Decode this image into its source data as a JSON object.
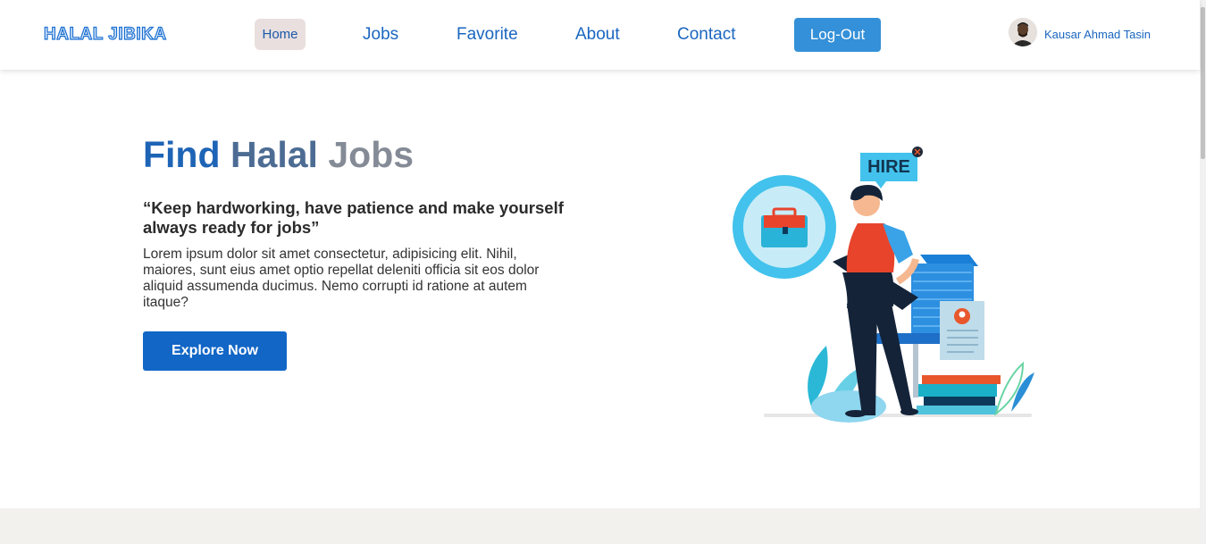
{
  "navbar": {
    "logo": "HALAL JIBIKA",
    "links": [
      "Home",
      "Jobs",
      "Favorite",
      "About",
      "Contact"
    ],
    "logout_label": "Log-Out",
    "user_name": "Kausar Ahmad Tasin"
  },
  "hero": {
    "title_part1": "Find",
    "title_part2": "Halal",
    "title_part3": "Jobs",
    "quote": "“Keep hardworking, have patience and make yourself always ready for jobs”",
    "description": "Lorem ipsum dolor sit amet consectetur, adipisicing elit. Nihil, maiores, sunt eius amet optio repellat deleniti officia sit eos dolor aliquid assumenda ducimus. Nemo corrupti id ratione at autem itaque?",
    "cta_label": "Explore Now",
    "illustration_sign": "HIRE"
  },
  "colors": {
    "accent": "#1166c6",
    "logout": "#3490d8",
    "home_pill": "#e9dfdf"
  }
}
